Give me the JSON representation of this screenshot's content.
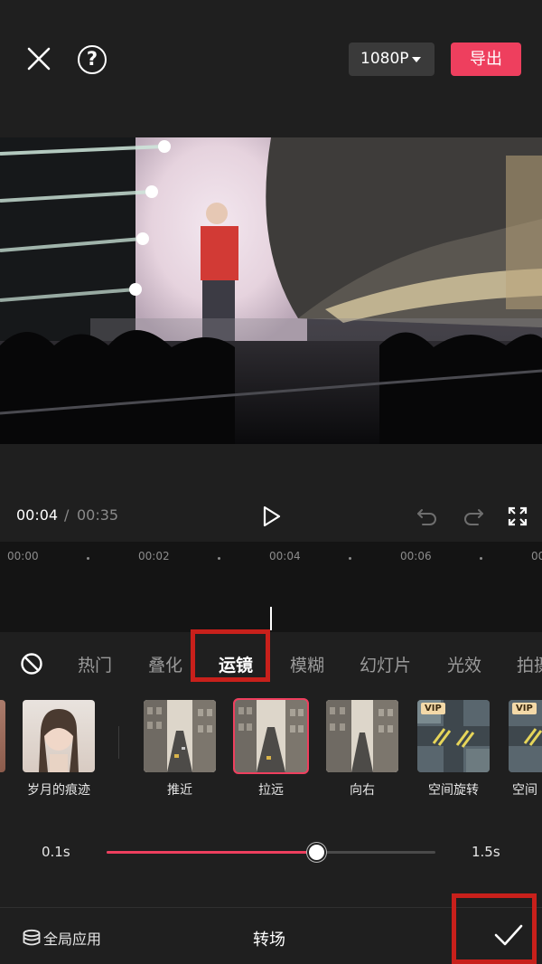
{
  "header": {
    "resolution_label": "1080P",
    "export_label": "导出"
  },
  "player": {
    "current_time": "00:04",
    "separator": "/",
    "total_time": "00:35"
  },
  "timeline": {
    "ticks": [
      "00:00",
      "00:02",
      "00:04",
      "00:06",
      "00"
    ]
  },
  "tabs": {
    "items": [
      "热门",
      "叠化",
      "运镜",
      "模糊",
      "幻灯片",
      "光效",
      "拍摄"
    ],
    "active": "运镜"
  },
  "effects": {
    "items": [
      {
        "label": "岁月的痕迹",
        "vip": false
      },
      {
        "label": "推近",
        "vip": false
      },
      {
        "label": "拉远",
        "vip": false,
        "selected": true
      },
      {
        "label": "向右",
        "vip": false
      },
      {
        "label": "空间旋转",
        "vip": true
      },
      {
        "label": "空间",
        "vip": true
      }
    ],
    "vip_badge": "VIP"
  },
  "duration_slider": {
    "min_label": "0.1s",
    "max_label": "1.5s",
    "value_fraction": 0.64
  },
  "footer": {
    "apply_all_label": "全局应用",
    "panel_title": "转场"
  },
  "colors": {
    "accent": "#ee3f5e",
    "background": "#1f1f1f",
    "annotation_box": "#c8201b"
  }
}
